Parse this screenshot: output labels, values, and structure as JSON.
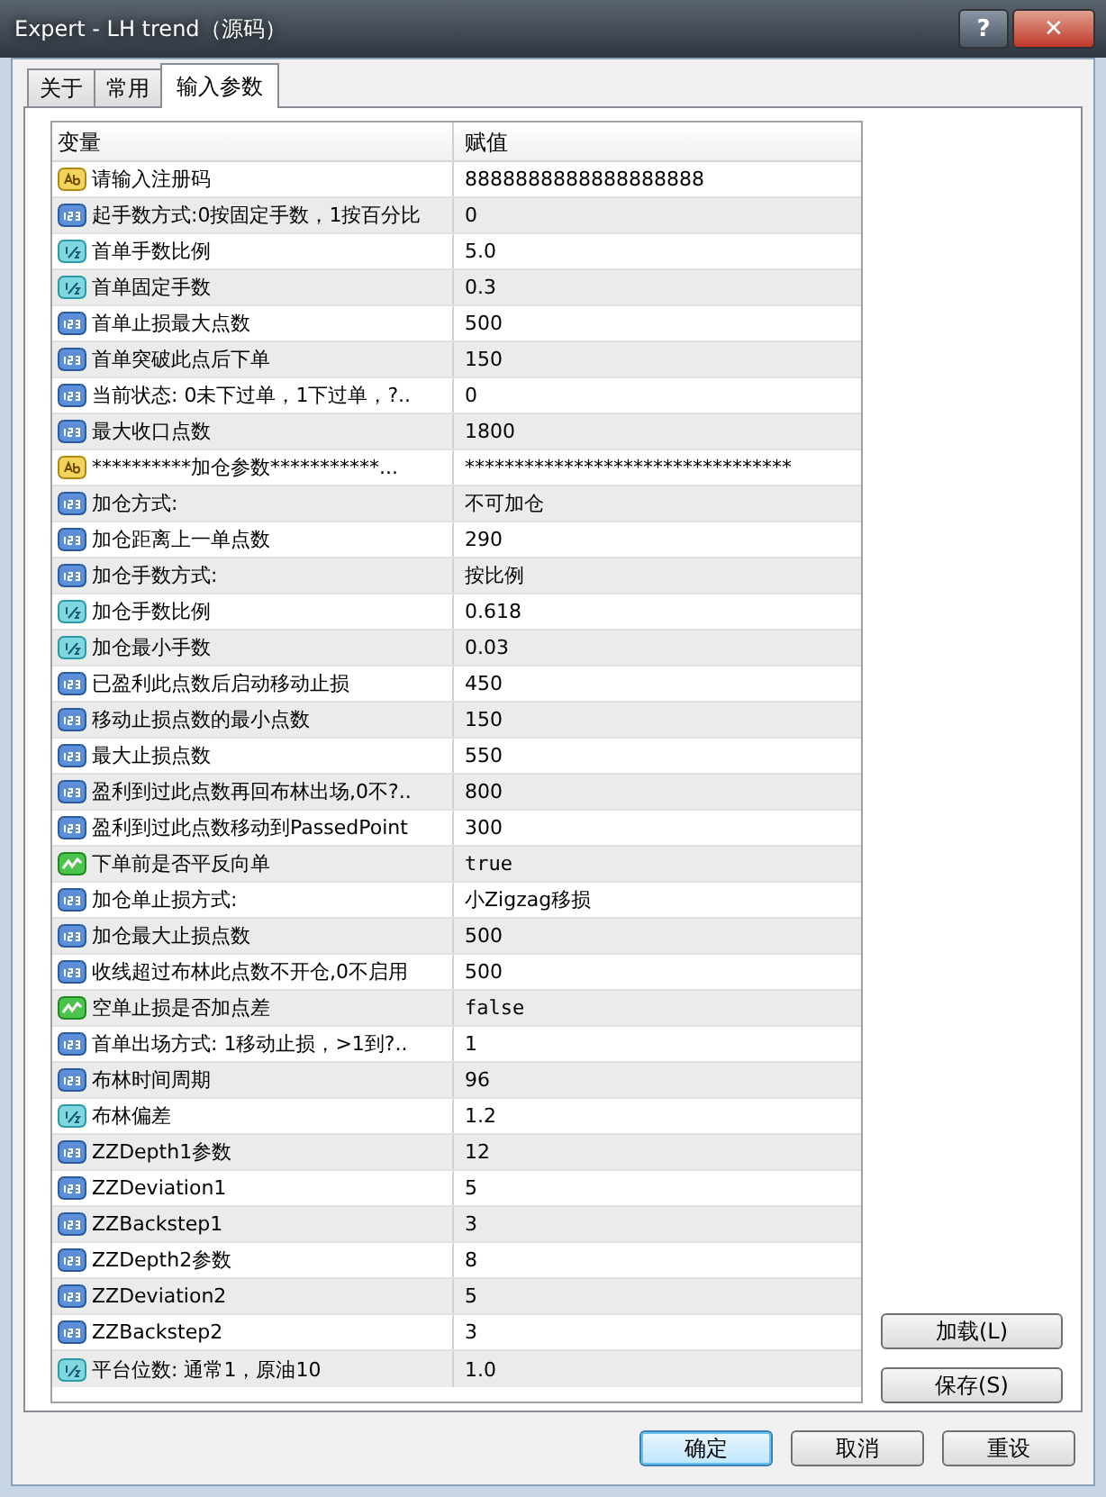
{
  "window": {
    "title": "Expert - LH trend（源码）",
    "help_button": "?",
    "close_button": "✕"
  },
  "tabs": [
    {
      "label": "关于",
      "selected": false
    },
    {
      "label": "常用",
      "selected": false
    },
    {
      "label": "输入参数",
      "selected": true
    }
  ],
  "table": {
    "columns": [
      "变量",
      "赋值"
    ],
    "rows": [
      {
        "kind": "string",
        "name": "请输入注册码",
        "value": "8888888888888888888"
      },
      {
        "kind": "int",
        "name": "起手数方式:0按固定手数，1按百分比",
        "value": "0"
      },
      {
        "kind": "double",
        "name": "首单手数比例",
        "value": "5.0"
      },
      {
        "kind": "double",
        "name": "首单固定手数",
        "value": "0.3"
      },
      {
        "kind": "int",
        "name": "首单止损最大点数",
        "value": "500"
      },
      {
        "kind": "int",
        "name": "首单突破此点后下单",
        "value": "150"
      },
      {
        "kind": "int",
        "name": "当前状态: 0未下过单，1下过单，?..",
        "value": "0"
      },
      {
        "kind": "int",
        "name": "最大收口点数",
        "value": "1800"
      },
      {
        "kind": "string",
        "name": "**********加仓参数***********...",
        "value": "*********************************"
      },
      {
        "kind": "int",
        "name": "加仓方式:",
        "value": "不可加仓"
      },
      {
        "kind": "int",
        "name": "加仓距离上一单点数",
        "value": "290"
      },
      {
        "kind": "int",
        "name": "加仓手数方式:",
        "value": "按比例"
      },
      {
        "kind": "double",
        "name": "加仓手数比例",
        "value": "0.618"
      },
      {
        "kind": "double",
        "name": "加仓最小手数",
        "value": "0.03"
      },
      {
        "kind": "int",
        "name": "已盈利此点数后启动移动止损",
        "value": "450"
      },
      {
        "kind": "int",
        "name": "移动止损点数的最小点数",
        "value": "150"
      },
      {
        "kind": "int",
        "name": "最大止损点数",
        "value": "550"
      },
      {
        "kind": "int",
        "name": "盈利到过此点数再回布林出场,0不?..",
        "value": "800"
      },
      {
        "kind": "int",
        "name": "盈利到过此点数移动到PassedPoint",
        "value": "300"
      },
      {
        "kind": "bool",
        "name": "下单前是否平反向单",
        "value": "true"
      },
      {
        "kind": "int",
        "name": "加仓单止损方式:",
        "value": "小Zigzag移损"
      },
      {
        "kind": "int",
        "name": "加仓最大止损点数",
        "value": "500"
      },
      {
        "kind": "int",
        "name": "收线超过布林此点数不开仓,0不启用",
        "value": "500"
      },
      {
        "kind": "bool",
        "name": "空单止损是否加点差",
        "value": "false"
      },
      {
        "kind": "int",
        "name": "首单出场方式: 1移动止损，>1到?..",
        "value": "1"
      },
      {
        "kind": "int",
        "name": "布林时间周期",
        "value": "96"
      },
      {
        "kind": "double",
        "name": "布林偏差",
        "value": "1.2"
      },
      {
        "kind": "int",
        "name": "ZZDepth1参数",
        "value": "12"
      },
      {
        "kind": "int",
        "name": "ZZDeviation1",
        "value": "5"
      },
      {
        "kind": "int",
        "name": "ZZBackstep1",
        "value": "3"
      },
      {
        "kind": "int",
        "name": "ZZDepth2参数",
        "value": "8"
      },
      {
        "kind": "int",
        "name": "ZZDeviation2",
        "value": "5"
      },
      {
        "kind": "int",
        "name": "ZZBackstep2",
        "value": "3"
      },
      {
        "kind": "double",
        "name": "平台位数: 通常1，原油10",
        "value": "1.0"
      }
    ]
  },
  "side_buttons": [
    "加载(L)",
    "保存(S)"
  ],
  "buttons": [
    {
      "label": "确定",
      "default": true
    },
    {
      "label": "取消",
      "default": false
    },
    {
      "label": "重设",
      "default": false
    }
  ]
}
